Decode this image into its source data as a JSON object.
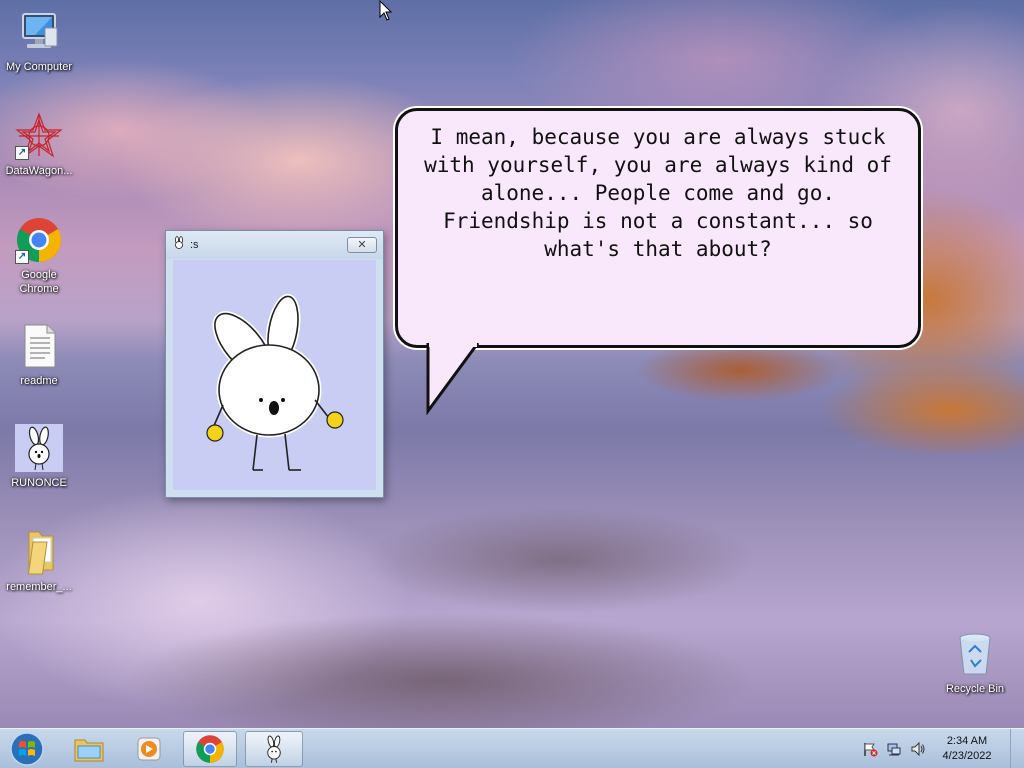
{
  "desktop": {
    "icons": [
      {
        "label": "My Computer",
        "icon": "computer-icon"
      },
      {
        "label": "DataWagon...",
        "icon": "datawagon-icon"
      },
      {
        "label": "Google Chrome",
        "icon": "chrome-icon"
      },
      {
        "label": "readme",
        "icon": "text-file-icon"
      },
      {
        "label": "RUNONCE",
        "icon": "bunny-icon"
      },
      {
        "label": "remember_...",
        "icon": "folder-icon"
      },
      {
        "label": "Recycle Bin",
        "icon": "recycle-bin-icon"
      }
    ]
  },
  "bunny_window": {
    "title": ":s",
    "close_glyph": "✕"
  },
  "speech_bubble": {
    "text": "I mean, because you are always stuck with yourself, you are always kind of alone... People come and go. Friendship is not a constant... so what's that about?"
  },
  "taskbar": {
    "start_icon": "windows-orb-icon",
    "pinned": [
      {
        "icon": "file-explorer-icon",
        "active": false
      },
      {
        "icon": "media-player-icon",
        "active": false
      },
      {
        "icon": "chrome-icon",
        "active": true
      },
      {
        "icon": "bunny-icon",
        "active": true
      }
    ],
    "tray_icons": [
      "action-center-flag-icon",
      "network-icon",
      "volume-icon"
    ],
    "clock": {
      "time": "2:34 AM",
      "date": "4/23/2022"
    }
  },
  "colors": {
    "bubble_fill": "#f9e8fb",
    "bunny_bg": "#c9cdf3",
    "taskbar": "#b9cce3"
  }
}
